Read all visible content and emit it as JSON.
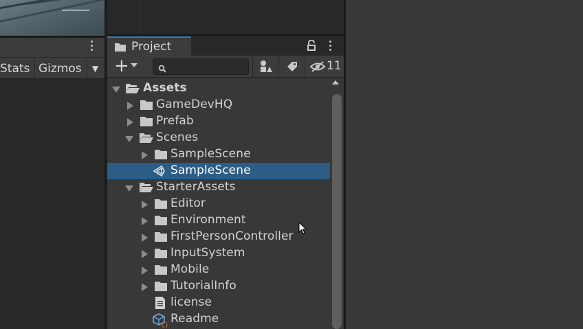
{
  "scene_toolbar": {
    "stats_label": "Stats",
    "gizmos_label": "Gizmos"
  },
  "project_panel": {
    "tab_label": "Project",
    "search": {
      "value": "",
      "placeholder": ""
    },
    "hidden_count": "11",
    "accent": "#3a79bb",
    "selection_color": "#2c5d87"
  },
  "tree": {
    "assets": "Assets",
    "gamedevhq": "GameDevHQ",
    "prefab": "Prefab",
    "scenes": "Scenes",
    "samplescene_folder": "SampleScene",
    "samplescene_file": "SampleScene",
    "starterassets": "StarterAssets",
    "editor": "Editor",
    "environment": "Environment",
    "firstpersoncontroller": "FirstPersonController",
    "inputsystem": "InputSystem",
    "mobile": "Mobile",
    "tutorialinfo": "TutorialInfo",
    "license": "license",
    "readme": "Readme"
  }
}
